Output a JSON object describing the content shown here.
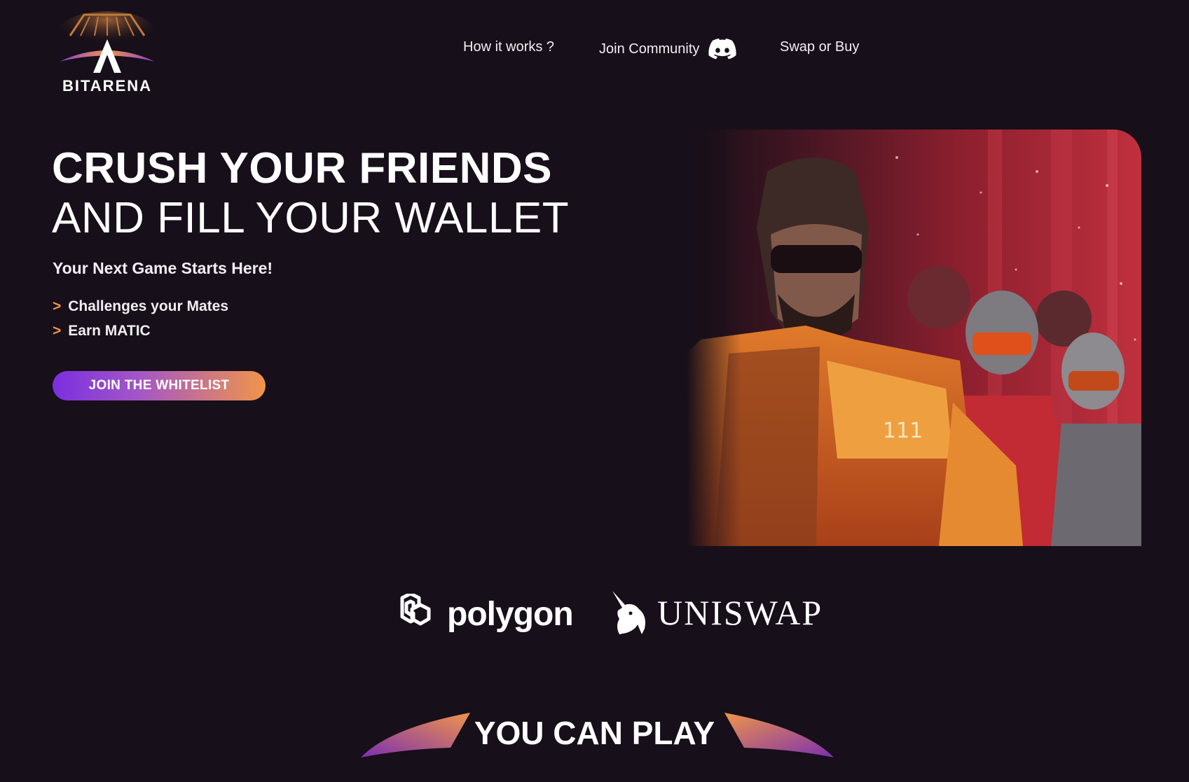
{
  "brand": {
    "name": "BITARENA"
  },
  "nav": {
    "how": "How it works ?",
    "join": "Join Community",
    "swap": "Swap or Buy"
  },
  "hero": {
    "headline_line1": "CRUSH YOUR FRIENDS",
    "headline_line2": "AND FILL YOUR WALLET",
    "subtitle": "Your Next Game Starts Here!",
    "bullet_marker": ">",
    "bullets": [
      "Challenges your Mates",
      "Earn MATIC"
    ],
    "cta": "JOIN THE WHITELIST"
  },
  "partners": {
    "polygon": "polygon",
    "uniswap": "UNISWAP"
  },
  "section": {
    "title": "YOU CAN PLAY"
  },
  "colors": {
    "background": "#170f19",
    "accent_orange": "#f0944a",
    "accent_purple": "#7b2fe0"
  }
}
